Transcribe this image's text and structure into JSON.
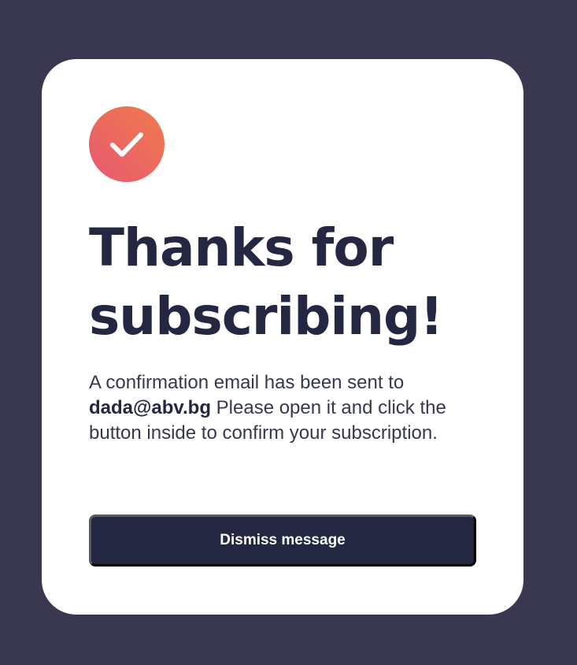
{
  "card": {
    "icon": "checkmark-icon",
    "title_line1": "Thanks for",
    "title_line2": "subscribing!",
    "message_prefix": "A confirmation email has been sent to",
    "email": "dada@abv.bg",
    "message_suffix": "Please open it and click the button inside to confirm your subscription.",
    "dismiss_label": "Dismiss message"
  },
  "colors": {
    "background": "#393850",
    "card": "#ffffff",
    "text_dark": "#242742",
    "badge_gradient_start": "#f07a4b",
    "badge_gradient_end": "#e65a72",
    "button_bg": "#242742"
  }
}
